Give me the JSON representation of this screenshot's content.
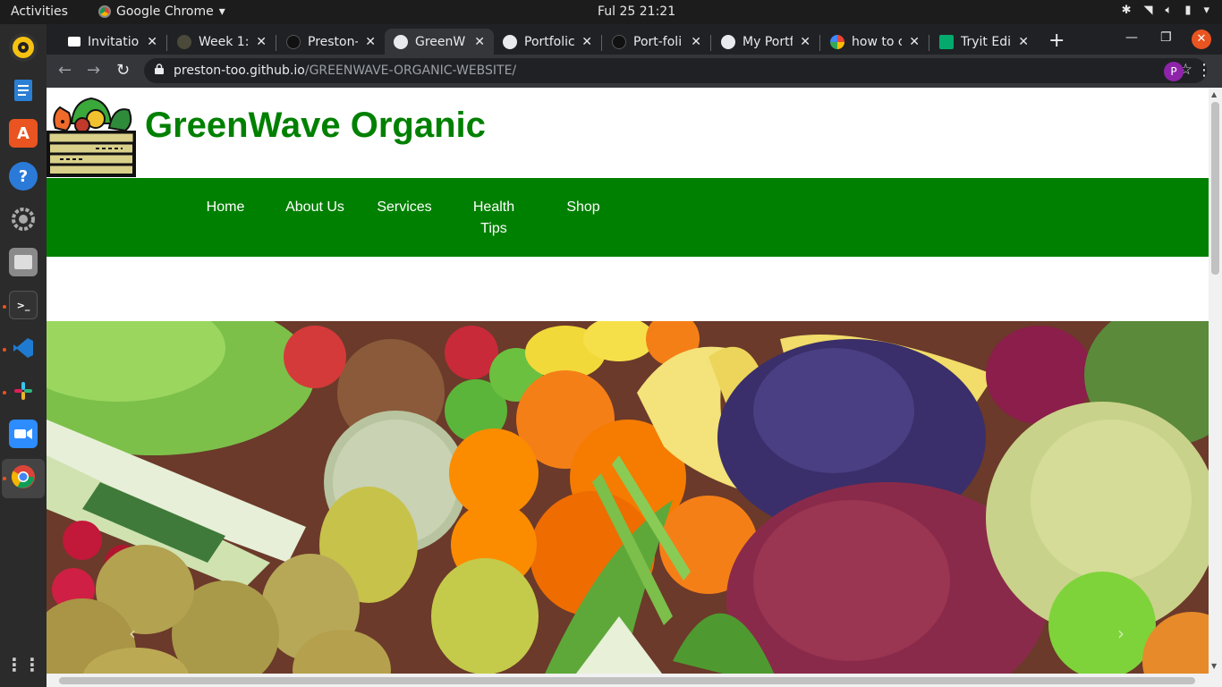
{
  "topbar": {
    "activities": "Activities",
    "app_name": "Google Chrome",
    "clock": "Ful 25  21:21"
  },
  "dock": {
    "items": [
      {
        "name": "rhythmbox",
        "color": "#f5c211"
      },
      {
        "name": "libreoffice-writer",
        "color": "#2a7fd4"
      },
      {
        "name": "ubuntu-software",
        "color": "#e95420"
      },
      {
        "name": "help",
        "color": "#2b7ad8"
      },
      {
        "name": "settings",
        "color": "#888888"
      },
      {
        "name": "files",
        "color": "#8a8a8a"
      },
      {
        "name": "terminal",
        "color": "#333333"
      },
      {
        "name": "vscode",
        "color": "#1e7bd1"
      },
      {
        "name": "slack",
        "color": "#ffffff"
      },
      {
        "name": "zoom",
        "color": "#2d8cff"
      },
      {
        "name": "chrome",
        "color": "#4285f4"
      }
    ]
  },
  "tabs": [
    {
      "label": "Invitatio",
      "icon": "gmail-icon"
    },
    {
      "label": "Week 1: ",
      "icon": "leaf-icon"
    },
    {
      "label": "Preston-",
      "icon": "github-icon"
    },
    {
      "label": "GreenW",
      "icon": "globe-icon",
      "active": true
    },
    {
      "label": "Portfolic",
      "icon": "globe-icon"
    },
    {
      "label": "Port-foli",
      "icon": "github-icon"
    },
    {
      "label": "My Portf",
      "icon": "globe-icon"
    },
    {
      "label": "how to c",
      "icon": "google-icon"
    },
    {
      "label": "Tryit Edi",
      "icon": "w3schools-icon"
    }
  ],
  "browser": {
    "url_host": "preston-too.github.io",
    "url_path": "/GREENWAVE-ORGANIC-WEBSITE/",
    "profile_initial": "P"
  },
  "site": {
    "title": "GreenWave Organic",
    "nav": [
      {
        "label": "Home"
      },
      {
        "label": "About Us"
      },
      {
        "label": "Services"
      },
      {
        "label": "Health Tips"
      },
      {
        "label": "Shop"
      }
    ],
    "brand_color": "#008000"
  }
}
